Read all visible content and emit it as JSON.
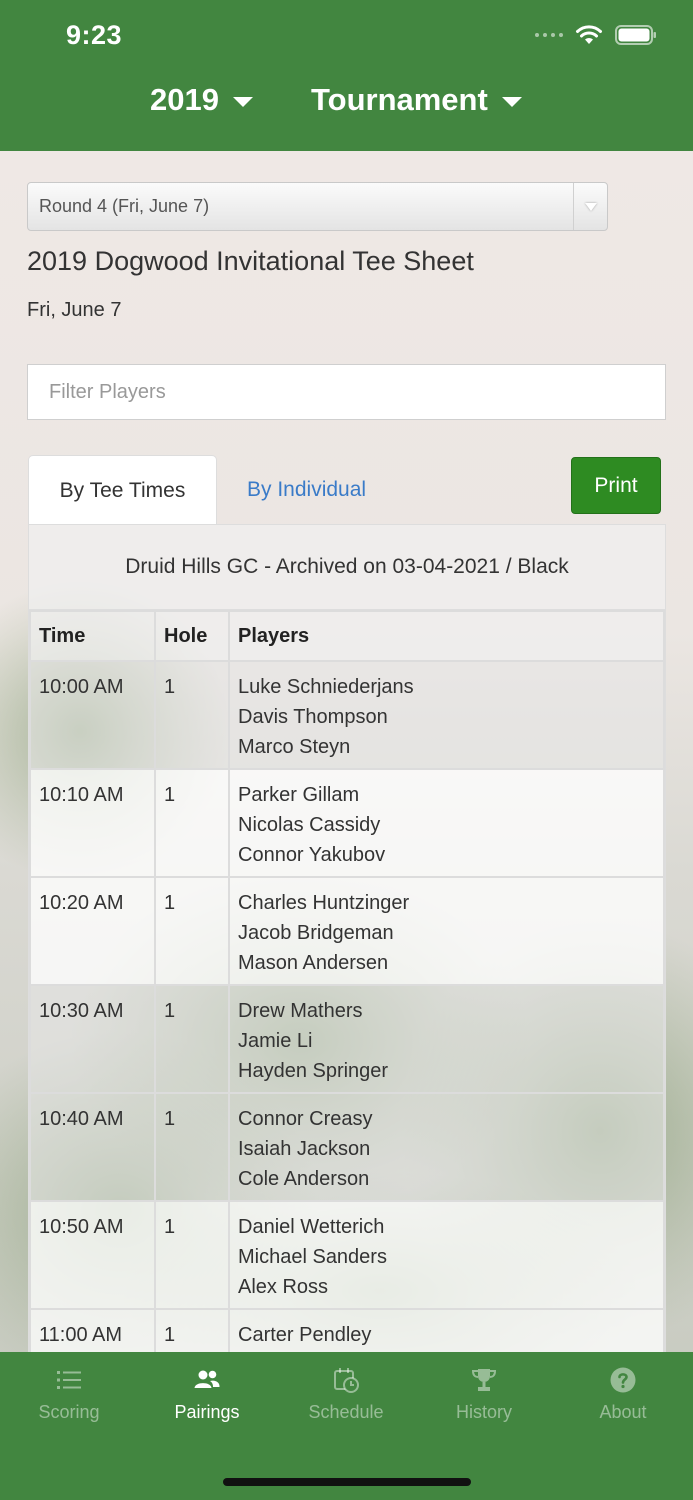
{
  "status_bar": {
    "time": "9:23"
  },
  "header": {
    "year": "2019",
    "event": "Tournament"
  },
  "round_select": {
    "value": "Round 4 (Fri, June 7)"
  },
  "page": {
    "title": "2019 Dogwood Invitational Tee Sheet",
    "date": "Fri, June 7"
  },
  "filter": {
    "placeholder": "Filter Players"
  },
  "tabs": {
    "by_tee_times": "By Tee Times",
    "by_individual": "By Individual"
  },
  "print_label": "Print",
  "course_line": "Druid Hills GC - Archived on 03-04-2021 / Black",
  "table": {
    "headers": [
      "Time",
      "Hole",
      "Players"
    ],
    "rows": [
      {
        "time": "10:00 AM",
        "hole": "1",
        "players": [
          "Luke Schniederjans",
          "Davis Thompson",
          "Marco Steyn"
        ]
      },
      {
        "time": "10:10 AM",
        "hole": "1",
        "players": [
          "Parker Gillam",
          "Nicolas Cassidy",
          "Connor Yakubov"
        ]
      },
      {
        "time": "10:20 AM",
        "hole": "1",
        "players": [
          "Charles Huntzinger",
          "Jacob Bridgeman",
          "Mason Andersen"
        ]
      },
      {
        "time": "10:30 AM",
        "hole": "1",
        "players": [
          "Drew Mathers",
          "Jamie Li",
          "Hayden Springer"
        ]
      },
      {
        "time": "10:40 AM",
        "hole": "1",
        "players": [
          "Connor Creasy",
          "Isaiah Jackson",
          "Cole Anderson"
        ]
      },
      {
        "time": "10:50 AM",
        "hole": "1",
        "players": [
          "Daniel Wetterich",
          "Michael Sanders",
          "Alex Ross"
        ]
      },
      {
        "time": "11:00 AM",
        "hole": "1",
        "players": [
          "Carter Pendley"
        ]
      }
    ]
  },
  "nav": {
    "items": [
      {
        "label": "Scoring",
        "icon": "list-icon"
      },
      {
        "label": "Pairings",
        "icon": "people-icon"
      },
      {
        "label": "Schedule",
        "icon": "calendar-clock-icon"
      },
      {
        "label": "History",
        "icon": "trophy-icon"
      },
      {
        "label": "About",
        "icon": "question-circle-icon"
      }
    ],
    "active": "Pairings"
  },
  "colors": {
    "header_green": "#428640",
    "print_green": "#2e8b22",
    "link_blue": "#3a7bc8"
  }
}
